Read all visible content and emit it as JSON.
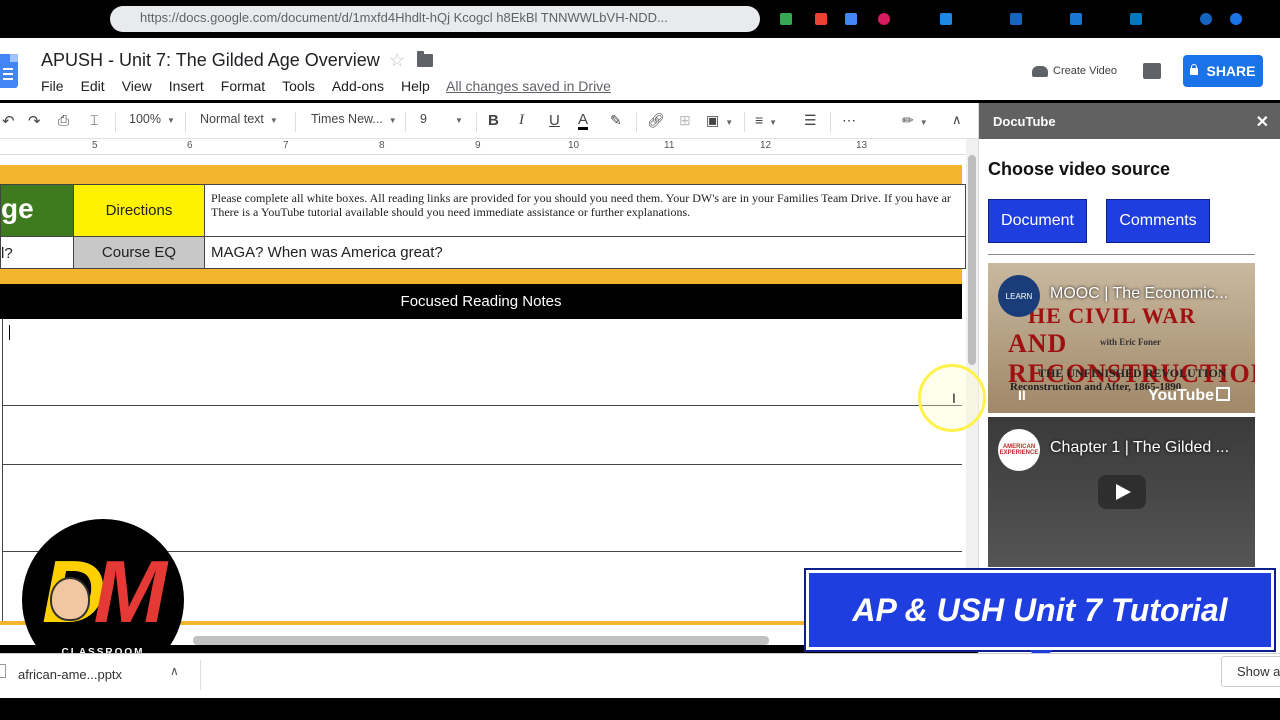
{
  "browser": {
    "url": "https://docs.google.com/document/d/1mxfd4Hhdlt-hQj Kcogcl h8EkBl TNNWWLbVH-NDD..."
  },
  "doc": {
    "title": "APUSH - Unit 7: The Gilded Age Overview",
    "star": "☆",
    "menu": [
      "File",
      "Edit",
      "View",
      "Insert",
      "Format",
      "Tools",
      "Add-ons",
      "Help"
    ],
    "saved_status": "All changes saved in Drive",
    "create_video": "Create Video",
    "share": "SHARE"
  },
  "toolbar": {
    "zoom": "100%",
    "style": "Normal text",
    "font": "Times New...",
    "size": "9",
    "bold": "B",
    "italic": "I",
    "underline": "U",
    "text_color": "A",
    "more": "⋯",
    "collapse": "∧"
  },
  "ruler": [
    "5",
    "6",
    "7",
    "8",
    "9",
    "10",
    "11",
    "12",
    "13"
  ],
  "table": {
    "green_cell": "ge",
    "directions_label": "Directions",
    "directions_line1": "Please complete all white boxes.  All reading links are provided for you should you need them.  Your DW's are in your Families Team Drive.  If you have ar",
    "directions_line2": "There is a YouTube tutorial available should you need immediate assistance or further explanations.",
    "q_cell": "l?",
    "course_eq_label": "Course EQ",
    "course_eq_text": "MAGA?  When was America great?",
    "notes_header": "Focused Reading Notes"
  },
  "sidepanel": {
    "title": "DocuTube",
    "close": "✕",
    "heading": "Choose video source",
    "btn_document": "Document",
    "btn_comments": "Comments",
    "video1_title": "MOOC | The Economic...",
    "video1_big": "HE CIVIL WAR",
    "video1_big2": "AND RECONSTRUCTION",
    "video1_sub": "with Eric Foner",
    "video1_rev": "THE UNFINISHED REVOLUTION",
    "video1_rev2": "Reconstruction and After, 1865-1890",
    "video1_avatar": "LEARN",
    "video2_title": "Chapter 1 | The Gilded ...",
    "video2_avatar": "AMERICAN EXPERIENCE",
    "youtube": "YouTube",
    "pause": "II"
  },
  "overlays": {
    "logo_letters_d": "D",
    "logo_letters_m": "M",
    "logo_caption": "CLASSROOM",
    "banner": "AP & USH Unit 7 Tutorial"
  },
  "download_bar": {
    "file": "african-ame...pptx",
    "show_all": "Show all"
  },
  "colors": {
    "accent_blue": "#1a73e8",
    "panel_blue": "#1f3ee0",
    "orange_band": "#f4b52e",
    "green_cell": "#3e7a1e",
    "yellow_cell": "#fff200"
  }
}
